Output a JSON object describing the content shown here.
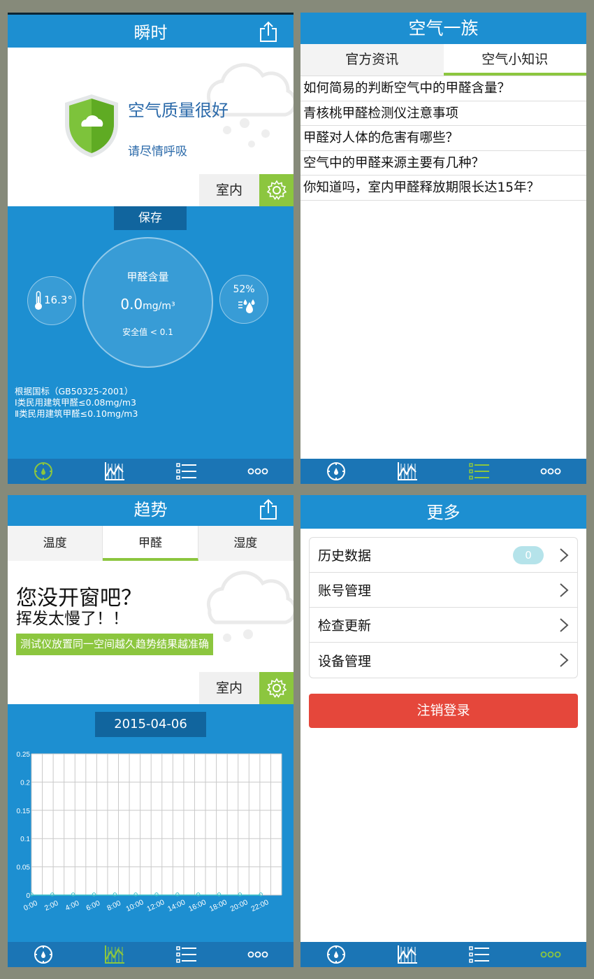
{
  "colors": {
    "primary_blue": "#1d8fd1",
    "dark_blue": "#11659e",
    "nav_blue": "#1b75b5",
    "accent_green": "#8cc63f",
    "danger_red": "#e5473b"
  },
  "screen1": {
    "title": "瞬时",
    "share_icon": "share-icon",
    "status_title": "空气质量很好",
    "status_subtitle": "请尽情呼吸",
    "location_label": "室内",
    "save_label": "保存",
    "formaldehyde_label": "甲醛含量",
    "formaldehyde_value": "0.0",
    "formaldehyde_unit": "mg/m³",
    "safe_value_label": "安全值 < 0.1",
    "temperature": "16.3°",
    "humidity": "52%",
    "standard_lines": [
      "根据国标（GB50325-2001）",
      "Ⅰ类民用建筑甲醛≤0.08mg/m3",
      "Ⅱ类民用建筑甲醛≤0.10mg/m3"
    ],
    "nav_active": 0
  },
  "screen2": {
    "title": "空气一族",
    "tabs": [
      "官方资讯",
      "空气小知识"
    ],
    "active_tab": 1,
    "articles": [
      "如何简易的判断空气中的甲醛含量？",
      "青核桃甲醛检测仪注意事项",
      "甲醛对人体的危害有哪些？",
      "空气中的甲醛来源主要有几种？",
      "你知道吗，室内甲醛释放期限长达15年？"
    ],
    "nav_active": 2
  },
  "screen3": {
    "title": "趋势",
    "tabs": [
      "温度",
      "甲醛",
      "湿度"
    ],
    "active_tab": 1,
    "advice_title": "您没开窗吧？",
    "advice_subtitle": "挥发太慢了！！",
    "advice_tip": "测试仪放置同一空间越久趋势结果越准确",
    "location_label": "室内",
    "date": "2015-04-06",
    "nav_active": 1
  },
  "screen4": {
    "title": "更多",
    "menu": [
      {
        "label": "历史数据",
        "badge": "0"
      },
      {
        "label": "账号管理"
      },
      {
        "label": "检查更新"
      },
      {
        "label": "设备管理"
      }
    ],
    "logout_label": "注销登录",
    "nav_active": 3
  },
  "nav_icons": [
    "compass-icon",
    "trend-chart-icon",
    "list-icon",
    "more-dots-icon"
  ],
  "chart_data": {
    "type": "line",
    "x": [
      "0:00",
      "2:00",
      "4:00",
      "6:00",
      "8:00",
      "10:00",
      "12:00",
      "14:00",
      "16:00",
      "18:00",
      "20:00",
      "22:00"
    ],
    "y_ticks": [
      "0",
      "0.05",
      "0.1",
      "0.15",
      "0.2",
      "0.25"
    ],
    "series": [
      {
        "values": [
          0,
          0,
          0,
          0,
          0,
          0,
          0,
          0,
          0,
          0,
          0,
          0
        ]
      }
    ],
    "ylim": [
      0,
      0.25
    ],
    "grid": true,
    "xlabel": "",
    "ylabel": ""
  }
}
